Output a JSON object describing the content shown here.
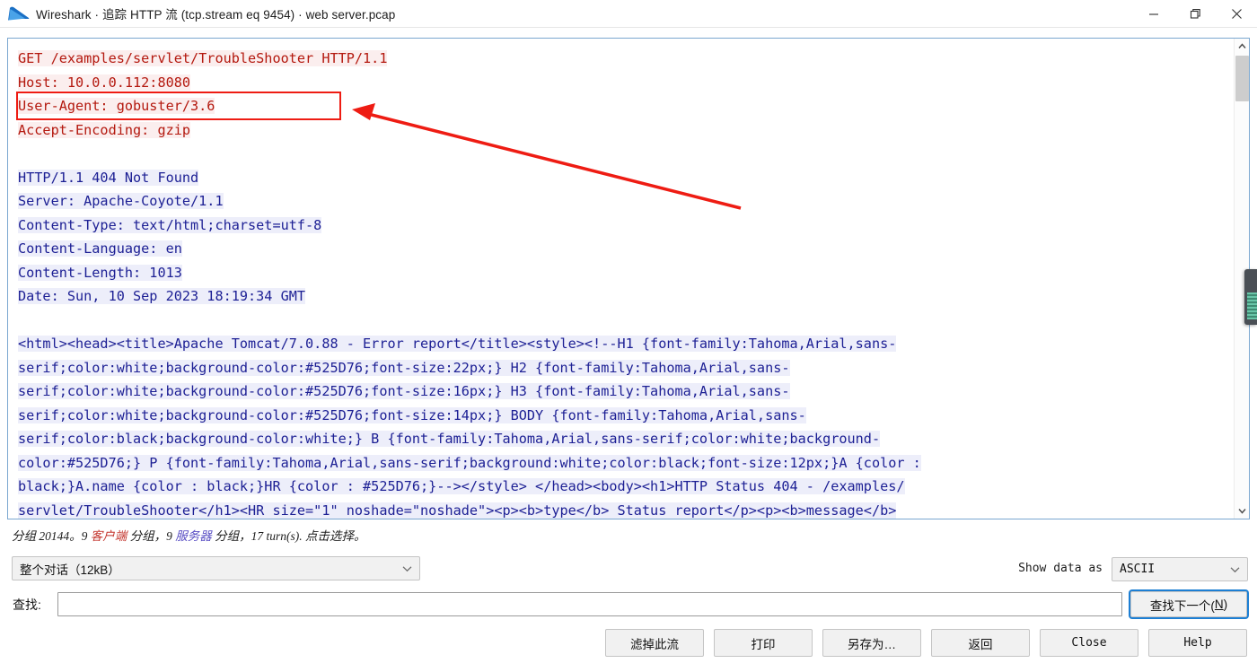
{
  "window": {
    "title": "Wireshark · 追踪 HTTP 流 (tcp.stream eq 9454) · web server.pcap",
    "icon": "wireshark-fin-icon",
    "controls": {
      "minimize": "minimize-icon",
      "maximize": "restore-icon",
      "close": "close-icon"
    }
  },
  "stream": {
    "request": {
      "lines": [
        "GET /examples/servlet/TroubleShooter HTTP/1.1",
        "Host: 10.0.0.112:8080",
        "User-Agent: gobuster/3.6",
        "Accept-Encoding: gzip"
      ],
      "text_color": "#b4190f",
      "highlight_color": "#fbeeee"
    },
    "response": {
      "header_lines": [
        "HTTP/1.1 404 Not Found",
        "Server: Apache-Coyote/1.1",
        "Content-Type: text/html;charset=utf-8",
        "Content-Language: en",
        "Content-Length: 1013",
        "Date: Sun, 10 Sep 2023 18:19:34 GMT"
      ],
      "body_lines": [
        "<html><head><title>Apache Tomcat/7.0.88 - Error report</title><style><!--H1 {font-family:Tahoma,Arial,sans-",
        "serif;color:white;background-color:#525D76;font-size:22px;} H2 {font-family:Tahoma,Arial,sans-",
        "serif;color:white;background-color:#525D76;font-size:16px;} H3 {font-family:Tahoma,Arial,sans-",
        "serif;color:white;background-color:#525D76;font-size:14px;} BODY {font-family:Tahoma,Arial,sans-",
        "serif;color:black;background-color:white;} B {font-family:Tahoma,Arial,sans-serif;color:white;background-",
        "color:#525D76;} P {font-family:Tahoma,Arial,sans-serif;background:white;color:black;font-size:12px;}A {color :",
        "black;}A.name {color : black;}HR {color : #525D76;}--></style> </head><body><h1>HTTP Status 404 - /examples/",
        "servlet/TroubleShooter</h1><HR size=\"1\" noshade=\"noshade\"><p><b>type</b> Status report</p><p><b>message</b>"
      ],
      "text_color": "#1c1f94",
      "highlight_color": "#edeefa"
    }
  },
  "annotation": {
    "box_target": "User-Agent: gobuster/3.6",
    "color": "#ee1c13",
    "arrow": "red-arrow"
  },
  "status": {
    "prefix": "分组 20144。",
    "client_count": "9",
    "client_word": "客户端",
    "client_suffix": " 分组，",
    "server_count": "9",
    "server_word": "服务器",
    "server_suffix": " 分组，17 turn(s). 点击选择。",
    "client_color": "#c3342c",
    "server_color": "#5a4fc4"
  },
  "controls": {
    "conversation_select": {
      "value": "整个对话（12kB）",
      "chevron": "chevron-down-icon"
    },
    "show_data_label": "Show data as",
    "show_data_select": {
      "value": "ASCII",
      "chevron": "chevron-down-icon"
    },
    "find_label": "查找:",
    "find_value": "",
    "find_placeholder": "",
    "find_next_label": "查找下一个(",
    "find_next_mnemonic": "N",
    "find_next_label_end": ")"
  },
  "buttons": [
    {
      "label": "滤掉此流",
      "name": "filter-out-stream-button",
      "mono": false
    },
    {
      "label": "打印",
      "name": "print-button",
      "mono": false
    },
    {
      "label": "另存为…",
      "name": "save-as-button",
      "mono": false
    },
    {
      "label": "返回",
      "name": "back-button",
      "mono": false
    },
    {
      "label": "Close",
      "name": "close-button",
      "mono": true
    },
    {
      "label": "Help",
      "name": "help-button",
      "mono": true
    }
  ],
  "scrollbar": {
    "up": "scroll-up-icon",
    "down": "scroll-down-icon",
    "thumb": "scroll-thumb"
  }
}
